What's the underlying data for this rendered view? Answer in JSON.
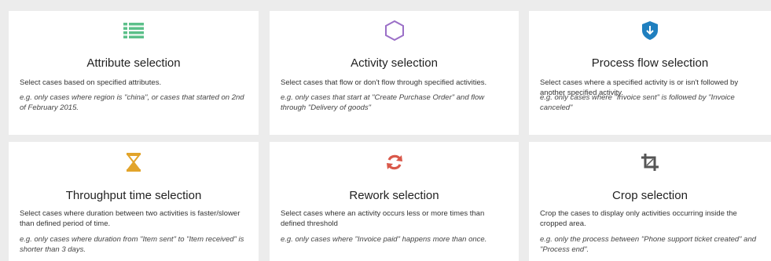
{
  "cards": [
    {
      "icon": "list-icon",
      "title": "Attribute selection",
      "description": "Select cases based on specified attributes.",
      "example": "e.g. only cases where region is \"china\", or cases that started on 2nd of February 2015."
    },
    {
      "icon": "hexagon-icon",
      "title": "Activity selection",
      "description": "Select cases that flow or don't flow through specified activities.",
      "example": "e.g. only cases that start at \"Create Purchase Order\" and flow through \"Delivery of goods\""
    },
    {
      "icon": "shield-arrow-icon",
      "title": "Process flow selection",
      "description": "Select cases where a specified activity is or isn't followed by another specified activity.",
      "example": "e.g. only cases where \"Invoice sent\" is followed by \"Invoice canceled\""
    },
    {
      "icon": "hourglass-icon",
      "title": "Throughput time selection",
      "description": "Select cases where duration between two activities is faster/slower than defined period of time.",
      "example": "e.g. only cases where duration from \"Item sent\" to \"Item received\" is shorter than 3 days."
    },
    {
      "icon": "refresh-icon",
      "title": "Rework selection",
      "description": "Select cases where an activity occurs less or more times than defined threshold",
      "example": "e.g. only cases where \"Invoice paid\" happens more than once."
    },
    {
      "icon": "crop-icon",
      "title": "Crop selection",
      "description": "Crop the cases to display only activities occurring inside the cropped area.",
      "example": "e.g. only the process between \"Phone support ticket created\" and \"Process end\"."
    }
  ],
  "colors": {
    "list": "#5cc08a",
    "hexagon": "#9b6fc7",
    "shield": "#1f7fbf",
    "hourglass": "#e2a42b",
    "refresh": "#d9584a",
    "crop": "#555555"
  }
}
